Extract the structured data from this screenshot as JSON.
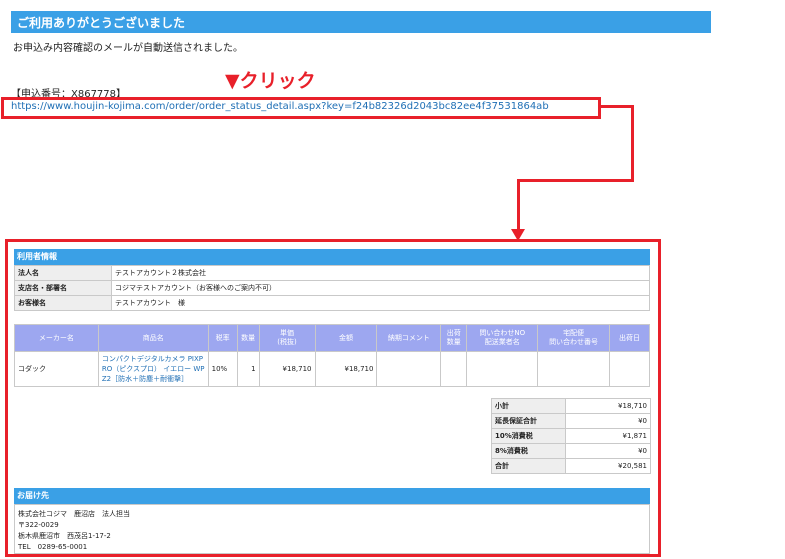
{
  "banner": {
    "title": "ご利用ありがとうございました"
  },
  "notice": "お申込み内容確認のメールが自動送信されました。",
  "order_number": "【申込番号：X867778】",
  "click_label": "▼クリック",
  "link_url": "https://www.houjin-kojima.com/order/order_status_detail.aspx?key=f24b82326d2043bc82ee4f37531864ab",
  "user_info": {
    "heading": "利用者情報",
    "rows": [
      {
        "label": "法人名",
        "value": "テストアカウント２株式会社"
      },
      {
        "label": "支店名・部署名",
        "value": "コジマテストアカウント（お客様へのご案内不可）"
      },
      {
        "label": "お客様名",
        "value": "テストアカウント　様"
      }
    ]
  },
  "order_table": {
    "headers": [
      "メーカー名",
      "商品名",
      "税率",
      "数量",
      "単価\n(税抜)",
      "金額",
      "納期コメント",
      "出荷\n数量",
      "問い合わせNO\n配送業者名",
      "宅配便\n問い合わせ番号",
      "出荷日"
    ],
    "row": {
      "maker": "コダック",
      "product": "コンパクトデジタルカメラ PIXPRO（ピクスプロ） イエロー WPZ2［防水＋防塵＋耐衝撃］",
      "product_lines": [
        "コンパクトデジタルカメラ PIXP",
        "RO（ピクスプロ） イエロー WP",
        "Z2［防水＋防塵＋耐衝撃］"
      ],
      "tax": "10%",
      "qty": "1",
      "unit_price": "¥18,710",
      "amount": "¥18,710",
      "delivery_comment": "",
      "ship_qty": "",
      "inquiry_no": "",
      "tracking_no": "",
      "ship_date": ""
    }
  },
  "summary": [
    {
      "label": "小計",
      "value": "¥18,710"
    },
    {
      "label": "延長保証合計",
      "value": "¥0"
    },
    {
      "label": "10%消費税",
      "value": "¥1,871"
    },
    {
      "label": "8%消費税",
      "value": "¥0"
    },
    {
      "label": "合計",
      "value": "¥20,581"
    }
  ],
  "shipping": {
    "heading": "お届け先",
    "lines": [
      "株式会社コジマ　鹿沼店　法人担当",
      "〒322-0029",
      "栃木県鹿沼市　西茂呂1-17-2",
      "TEL　0289-65-0001"
    ]
  },
  "colors": {
    "accent_blue": "#3aa0e6",
    "highlight_red": "#e8202a",
    "table_header": "#9da7f0",
    "link": "#1f6fb5"
  }
}
